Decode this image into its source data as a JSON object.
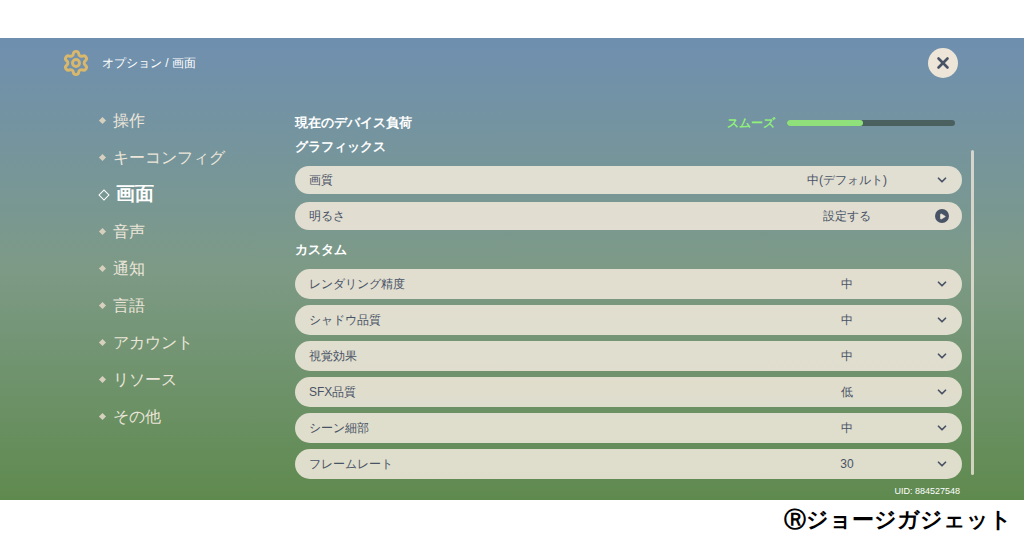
{
  "header": {
    "breadcrumb": "オプション / 画面"
  },
  "sidebar": {
    "items": [
      {
        "label": "操作",
        "selected": false
      },
      {
        "label": "キーコンフィグ",
        "selected": false
      },
      {
        "label": "画面",
        "selected": true
      },
      {
        "label": "音声",
        "selected": false
      },
      {
        "label": "通知",
        "selected": false
      },
      {
        "label": "言語",
        "selected": false
      },
      {
        "label": "アカウント",
        "selected": false
      },
      {
        "label": "リソース",
        "selected": false
      },
      {
        "label": "その他",
        "selected": false
      }
    ]
  },
  "device_load": {
    "label": "現在のデバイス負荷",
    "status": "スムーズ",
    "level": 0.45
  },
  "sections": [
    {
      "title": "グラフィックス",
      "rows": [
        {
          "label": "画質",
          "value": "中(デフォルト)",
          "kind": "dropdown"
        },
        {
          "label": "明るさ",
          "value": "設定する",
          "kind": "link"
        }
      ]
    },
    {
      "title": "カスタム",
      "rows": [
        {
          "label": "レンダリング精度",
          "value": "中",
          "kind": "dropdown"
        },
        {
          "label": "シャドウ品質",
          "value": "中",
          "kind": "dropdown"
        },
        {
          "label": "視覚効果",
          "value": "中",
          "kind": "dropdown"
        },
        {
          "label": "SFX品質",
          "value": "低",
          "kind": "dropdown"
        },
        {
          "label": "シーン細部",
          "value": "中",
          "kind": "dropdown"
        },
        {
          "label": "フレームレート",
          "value": "30",
          "kind": "dropdown"
        }
      ]
    }
  ],
  "uid": "UID: 884527548",
  "watermark": "Ⓡジョージガジェット"
}
